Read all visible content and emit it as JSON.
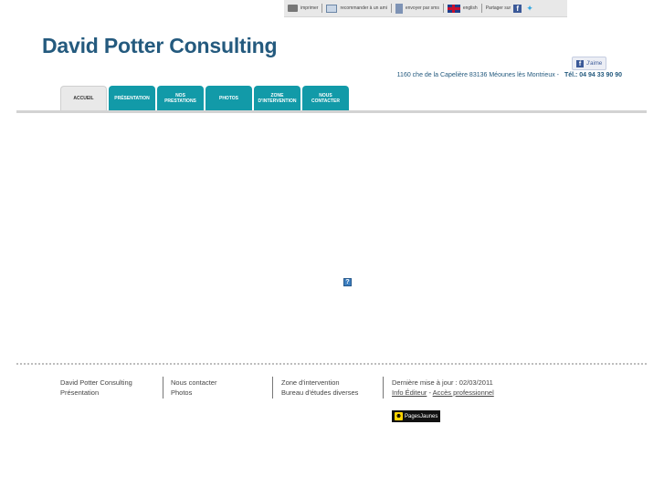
{
  "topbar": {
    "print_label": "imprimer",
    "recommend_label": "recommander à un ami",
    "send_label": "envoyer par sms",
    "english_label": "english",
    "share_label": "Partager sur"
  },
  "site": {
    "title": "David Potter Consulting",
    "address": "1160 che de la Capelière 83136 Méounes lès Montrieux -",
    "phone": "Tél.: 04 94 33 90 90"
  },
  "facebook": {
    "like_label": "J'aime"
  },
  "nav": {
    "tabs": [
      {
        "label": "ACCUEIL"
      },
      {
        "label": "PRÉSENTATION"
      },
      {
        "label": "NOS\nPRESTATIONS"
      },
      {
        "label": "PHOTOS"
      },
      {
        "label": "ZONE\nD'INTERVENTION"
      },
      {
        "label": "NOUS\nCONTACTER"
      }
    ]
  },
  "content": {
    "placeholder_symbol": "?"
  },
  "footer": {
    "col1": [
      "David Potter Consulting",
      "Présentation"
    ],
    "col2": [
      "Nous contacter",
      "Photos"
    ],
    "col3": [
      "Zone d'intervention",
      "Bureau d'études diverses"
    ],
    "col4": {
      "updated": "Dernière mise à jour : 02/03/2011",
      "info_editeur": "Info Éditeur",
      "separator": " - ",
      "acces_pro": "Accès professionnel"
    },
    "pagesjaunes_label": "PagesJaunes"
  },
  "colors": {
    "accent": "#129aa8",
    "title": "#245a7e"
  }
}
